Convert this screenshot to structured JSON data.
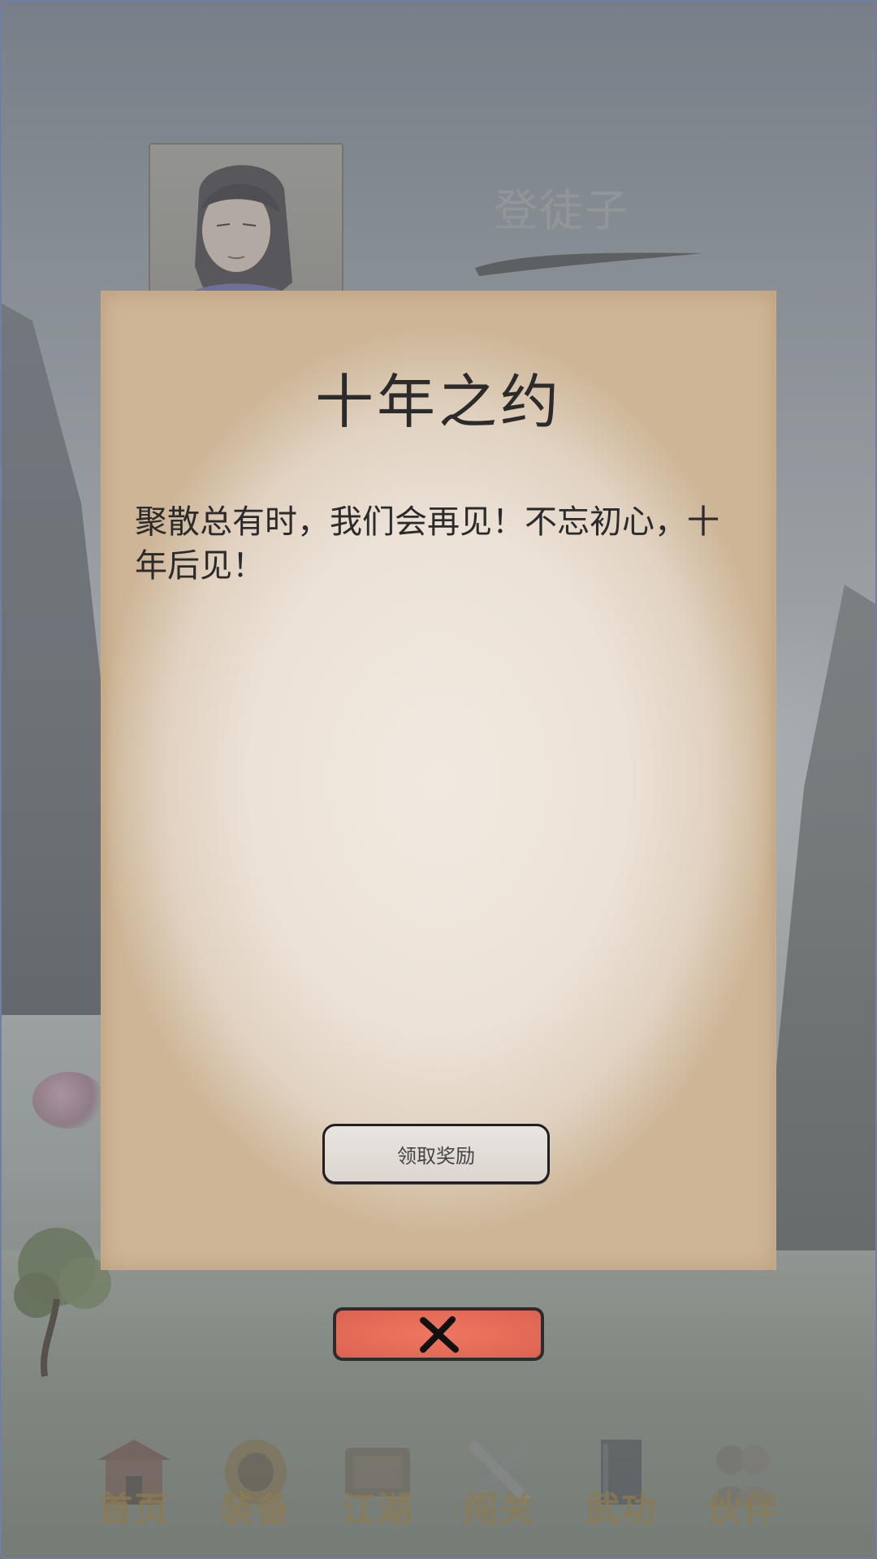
{
  "character": {
    "name": "登徒子"
  },
  "dialog": {
    "title": "十年之约",
    "body": "聚散总有时，我们会再见！不忘初心，十年后见！",
    "claim_button_label": "领取奖励",
    "close_icon": "close-icon"
  },
  "nav": {
    "items": [
      {
        "label": "首页",
        "icon": "home-pavilion-icon"
      },
      {
        "label": "装备",
        "icon": "armor-icon"
      },
      {
        "label": "江湖",
        "icon": "scroll-map-icon"
      },
      {
        "label": "闯关",
        "icon": "crossed-swords-icon"
      },
      {
        "label": "武功",
        "icon": "martial-book-icon"
      },
      {
        "label": "伙伴",
        "icon": "companions-icon"
      }
    ]
  },
  "colors": {
    "close_button": "#e26a55",
    "parchment": "#ece2d7",
    "nav_label": "#8c7b52"
  }
}
